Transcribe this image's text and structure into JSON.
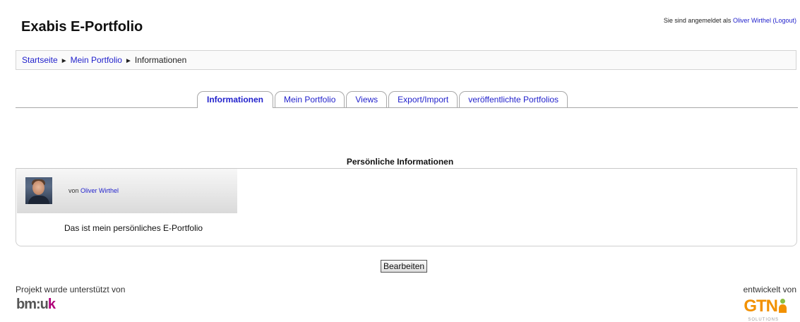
{
  "header": {
    "site_title": "Exabis E-Portfolio",
    "login_prefix": "Sie sind angemeldet als",
    "user_name": "Oliver Wirthel",
    "logout_label": "(Logout)"
  },
  "breadcrumb": {
    "home": "Startseite",
    "separator": "►",
    "portfolio": "Mein Portfolio",
    "current": "Informationen"
  },
  "tabs": [
    {
      "label": "Informationen",
      "active": true
    },
    {
      "label": "Mein Portfolio",
      "active": false
    },
    {
      "label": "Views",
      "active": false
    },
    {
      "label": "Export/Import",
      "active": false
    },
    {
      "label": "veröffentlichte Portfolios",
      "active": false
    }
  ],
  "main": {
    "heading": "Persönliche Informationen",
    "by_label": "von",
    "author": "Oliver Wirthel",
    "description": "Das ist mein persönliches E-Portfolio",
    "edit_label": "Bearbeiten"
  },
  "footer": {
    "supported_by": "Projekt wurde unterstützt von",
    "bmuk_logo": "bm:uk",
    "developed_by": "entwickelt von",
    "gtn_logo": "GTN",
    "gtn_sub": "SOLUTIONS"
  },
  "colors": {
    "link": "#2222cc",
    "tab_border": "#a8a8a8",
    "gtn_orange": "#f29100",
    "gtn_green": "#8cbf3f",
    "bmuk_magenta": "#b0007a"
  }
}
